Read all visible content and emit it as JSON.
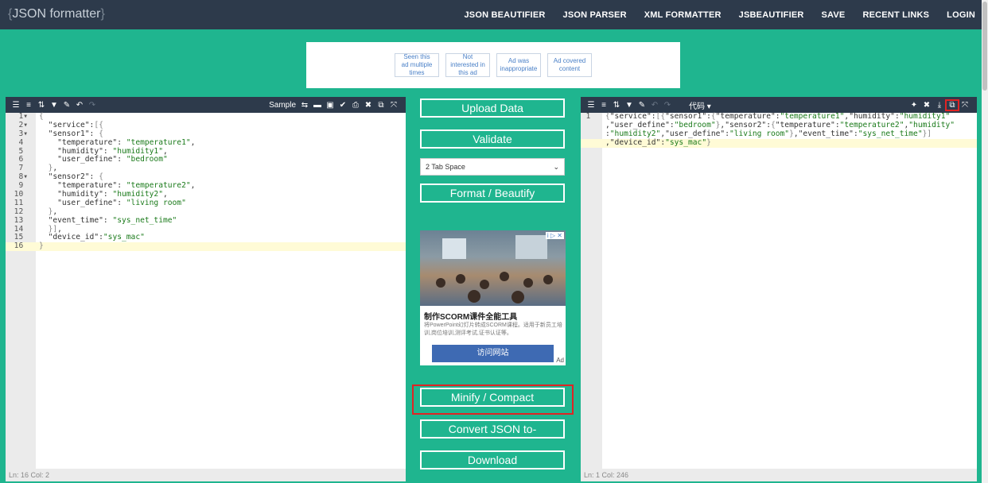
{
  "header": {
    "logo": "JSON formatter",
    "nav": [
      "JSON BEAUTIFIER",
      "JSON PARSER",
      "XML FORMATTER",
      "JSBEAUTIFIER",
      "SAVE",
      "RECENT LINKS",
      "LOGIN"
    ]
  },
  "adbanner": {
    "buttons": [
      "Seen this ad multiple times",
      "Not interested in this ad",
      "Ad was inappropriate",
      "Ad covered content"
    ]
  },
  "left_editor": {
    "toolbar_sample": "Sample",
    "lines": [
      {
        "n": "1",
        "fold": true,
        "text": "{"
      },
      {
        "n": "2",
        "fold": true,
        "text": "  \"service\":[{"
      },
      {
        "n": "3",
        "fold": true,
        "text": "  \"sensor1\": {"
      },
      {
        "n": "4",
        "fold": false,
        "text": "    \"temperature\": \"temperature1\","
      },
      {
        "n": "5",
        "fold": false,
        "text": "    \"humidity\": \"humidity1\","
      },
      {
        "n": "6",
        "fold": false,
        "text": "    \"user_define\": \"bedroom\""
      },
      {
        "n": "7",
        "fold": false,
        "text": "  },"
      },
      {
        "n": "8",
        "fold": true,
        "text": "  \"sensor2\": {"
      },
      {
        "n": "9",
        "fold": false,
        "text": "    \"temperature\": \"temperature2\","
      },
      {
        "n": "10",
        "fold": false,
        "text": "    \"humidity\": \"humidity2\","
      },
      {
        "n": "11",
        "fold": false,
        "text": "    \"user_define\": \"living room\""
      },
      {
        "n": "12",
        "fold": false,
        "text": "  },"
      },
      {
        "n": "13",
        "fold": false,
        "text": "  \"event_time\": \"sys_net_time\""
      },
      {
        "n": "14",
        "fold": false,
        "text": "  }],"
      },
      {
        "n": "15",
        "fold": false,
        "text": "  \"device_id\":\"sys_mac\""
      },
      {
        "n": "16",
        "fold": false,
        "text": "}"
      }
    ],
    "status": "Ln: 16   Col: 2"
  },
  "middle": {
    "upload": "Upload Data",
    "validate": "Validate",
    "tab_option": "2 Tab Space",
    "format": "Format / Beautify",
    "minify": "Minify / Compact",
    "convert": "Convert JSON to-",
    "download": "Download"
  },
  "ad": {
    "title": "制作SCORM课件全能工具",
    "desc": "将PowerPoint幻灯片转成SCORM课程。适用于新员工培训,岗位培训,测评考试,证书认证等。",
    "visit": "访问网站",
    "tag": "Ad",
    "close": "i ▷ ✕"
  },
  "right_editor": {
    "toolbar_label": "代码 ▾",
    "lines": [
      {
        "n": "1",
        "text": "{\"service\":[{\"sensor1\":{\"temperature\":\"temperature1\",\"humidity\":\"humidity1\""
      },
      {
        "n": "",
        "text": ",\"user_define\":\"bedroom\"},\"sensor2\":{\"temperature\":\"temperature2\",\"humidity\""
      },
      {
        "n": "",
        "text": ":\"humidity2\",\"user_define\":\"living room\"},\"event_time\":\"sys_net_time\"}]"
      },
      {
        "n": "",
        "text": ",\"device_id\":\"sys_mac\"}"
      }
    ],
    "status": "Ln: 1   Col: 246"
  }
}
